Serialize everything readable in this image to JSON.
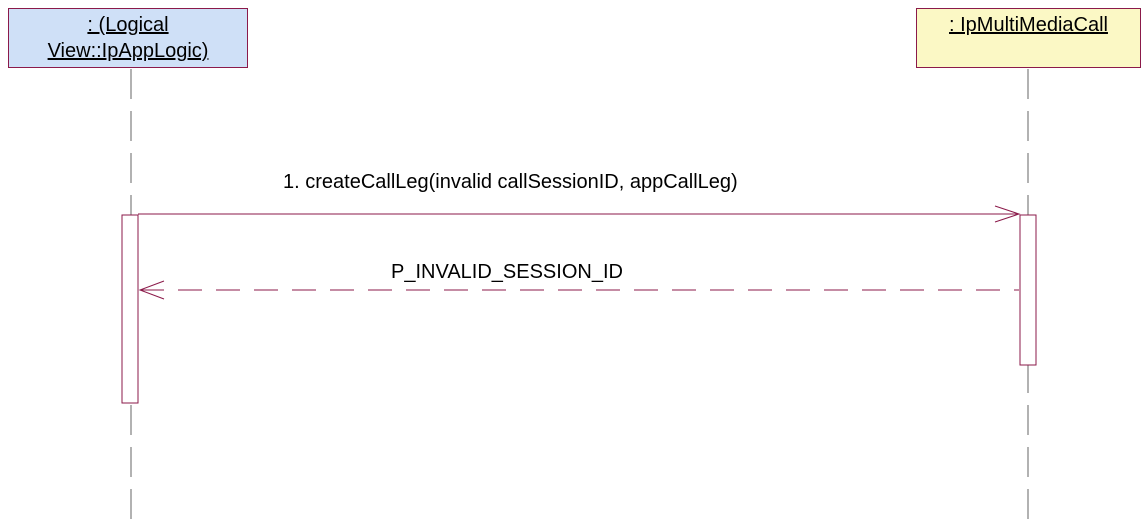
{
  "participants": {
    "left": {
      "line1": ": (Logical",
      "line2": "View::IpAppLogic)",
      "fill": "#cfe0f7"
    },
    "right": {
      "label": ": IpMultiMediaCall",
      "fill": "#fbf8c5"
    }
  },
  "messages": [
    {
      "label": "1. createCallLeg(invalid callSessionID, appCallLeg)",
      "type": "call"
    },
    {
      "label": "P_INVALID_SESSION_ID",
      "type": "return"
    }
  ],
  "colors": {
    "line": "#8b1a4a"
  }
}
